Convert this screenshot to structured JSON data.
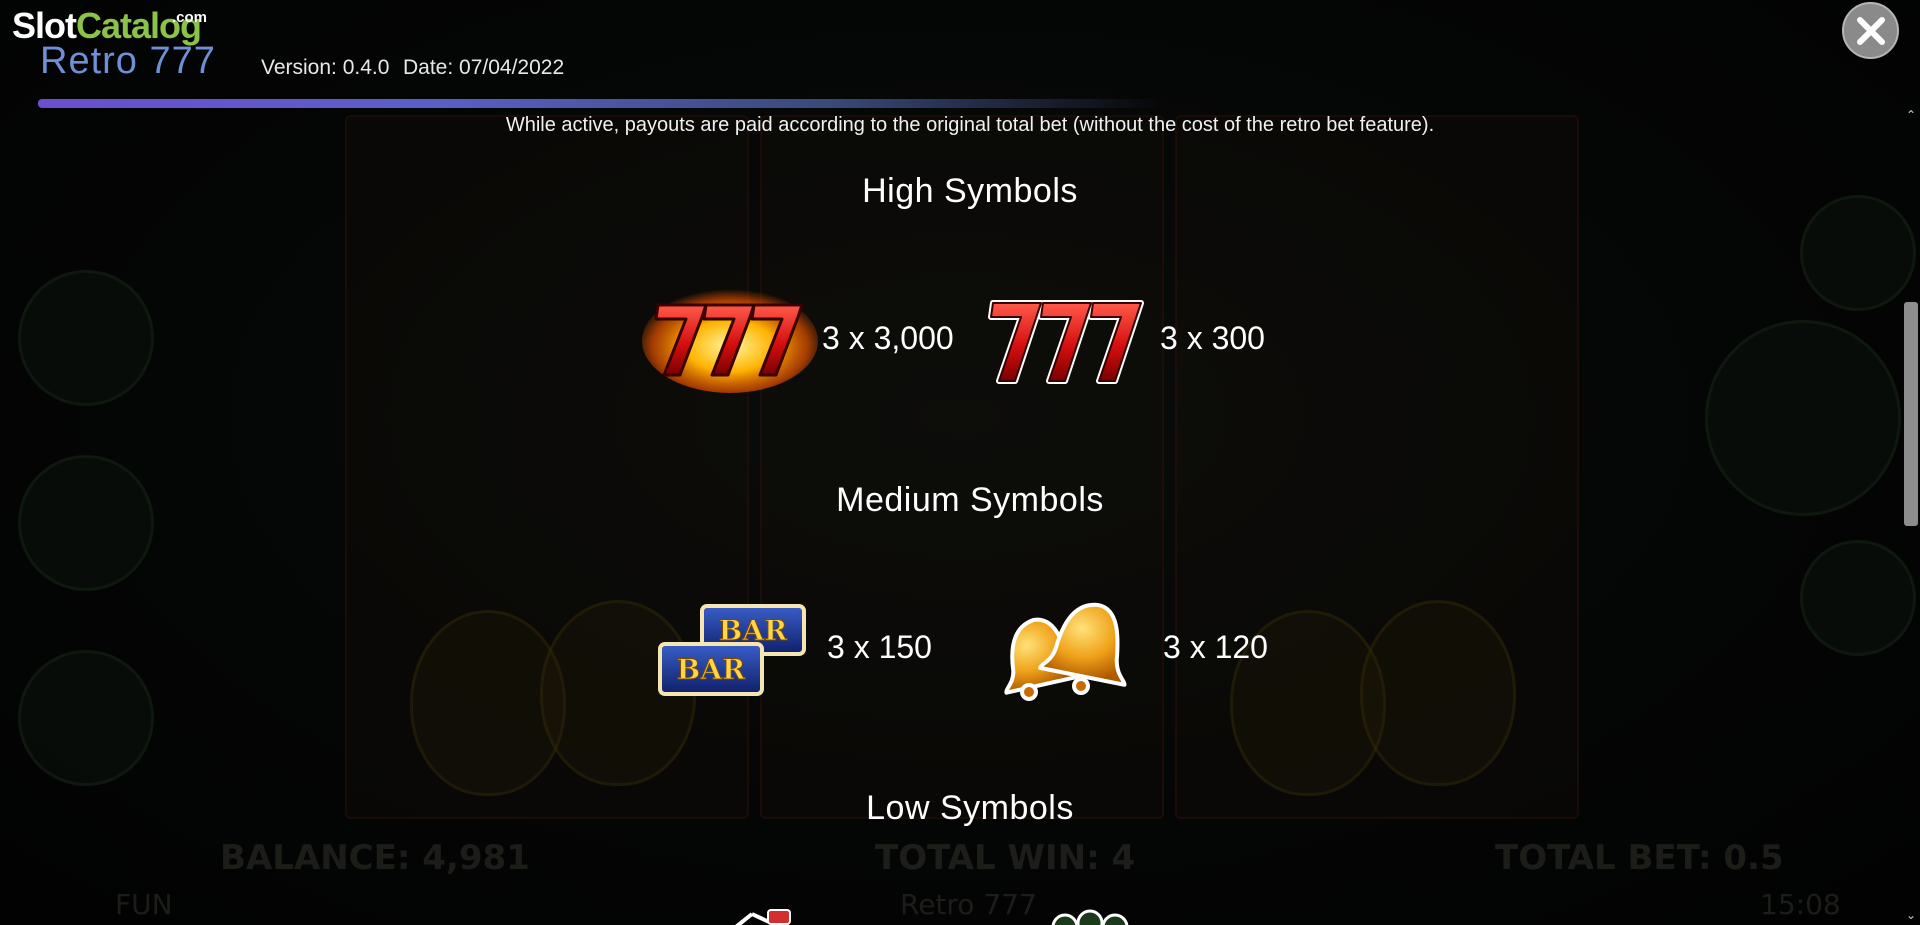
{
  "header": {
    "logo_slot": "Slot",
    "logo_catalog": "Catalog",
    "logo_com": ".com",
    "game_title": "Retro 777",
    "version": "Version: 0.4.0",
    "date": "Date: 07/04/2022"
  },
  "paytable": {
    "note": "While active, payouts are paid according to the original total bet (without the cost of the retro bet feature).",
    "high": {
      "title": "High Symbols",
      "items": [
        {
          "icon": "fire-777-icon",
          "payout": "3 x 3,000"
        },
        {
          "icon": "red-777-icon",
          "payout": "3 x 300"
        }
      ]
    },
    "medium": {
      "title": "Medium Symbols",
      "items": [
        {
          "icon": "double-bar-icon",
          "payout": "3 x 150"
        },
        {
          "icon": "bells-icon",
          "payout": "3 x 120"
        }
      ]
    },
    "low": {
      "title": "Low Symbols"
    }
  },
  "background_game": {
    "balance": "BALANCE: 4,981",
    "total_win": "TOTAL WIN: 4",
    "total_bet": "TOTAL BET: 0.5",
    "mode": "FUN",
    "title": "Retro 777",
    "clock": "15:08"
  },
  "colors": {
    "title_blue": "#6f8fd6",
    "logo_green": "#8bc34a",
    "rule_purple": "#6a4fcf",
    "close_grey": "#8a8a8a"
  }
}
